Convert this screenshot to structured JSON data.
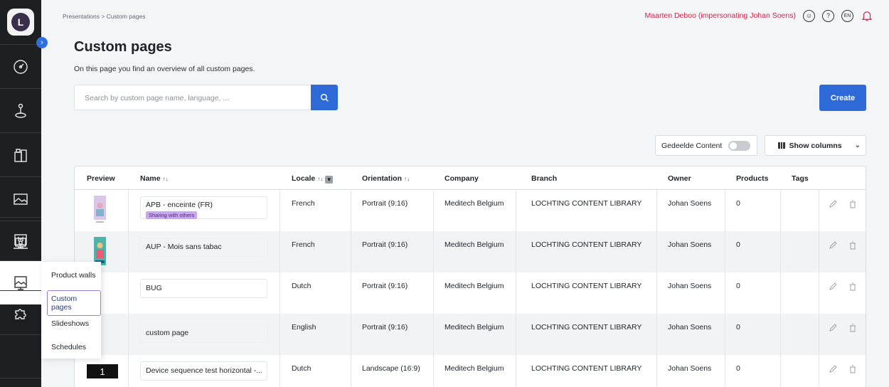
{
  "breadcrumb": "Presentations  >  Custom pages",
  "user": {
    "name": "Maarten Deboo (impersonating Johan Soens)",
    "help": "?",
    "lang": "EN"
  },
  "page": {
    "title": "Custom pages",
    "subtitle": "On this page you find an overview of all custom pages."
  },
  "search": {
    "placeholder": "Search by custom page name, language, ..."
  },
  "create_label": "Create",
  "shared_toggle_label": "Gedeelde Content",
  "show_columns_label": "Show columns",
  "submenu": [
    "Product walls",
    "Custom pages",
    "Slideshows",
    "Schedules"
  ],
  "columns": {
    "preview": "Preview",
    "name": "Name",
    "locale": "Locale",
    "orientation": "Orientation",
    "company": "Company",
    "branch": "Branch",
    "owner": "Owner",
    "products": "Products",
    "tags": "Tags"
  },
  "rows": [
    {
      "name": "APB - enceinte (FR)",
      "badge": "Sharing with others",
      "locale": "French",
      "orientation": "Portrait (9:16)",
      "company": "Meditech Belgium",
      "branch": "LOCHTING CONTENT LIBRARY",
      "owner": "Johan Soens",
      "products": "0"
    },
    {
      "name": "AUP - Mois sans tabac",
      "locale": "French",
      "orientation": "Portrait (9:16)",
      "company": "Meditech Belgium",
      "branch": "LOCHTING CONTENT LIBRARY",
      "owner": "Johan Soens",
      "products": "0"
    },
    {
      "name": "BUG",
      "locale": "Dutch",
      "orientation": "Portrait (9:16)",
      "company": "Meditech Belgium",
      "branch": "LOCHTING CONTENT LIBRARY",
      "owner": "Johan Soens",
      "products": "0"
    },
    {
      "name": "custom page",
      "locale": "English",
      "orientation": "Portrait (9:16)",
      "company": "Meditech Belgium",
      "branch": "LOCHTING CONTENT LIBRARY",
      "owner": "Johan Soens",
      "products": "0"
    },
    {
      "name": "Device sequence test horizontal -...",
      "preview_tag": "1",
      "locale": "Dutch",
      "orientation": "Landscape (16:9)",
      "company": "Meditech Belgium",
      "branch": "LOCHTING CONTENT LIBRARY",
      "owner": "Johan Soens",
      "products": "0"
    }
  ],
  "colors": {
    "accent": "#2d6ad8",
    "user": "#d0234a",
    "badge": "#c9a8f0",
    "sidebar": "#1e1f21"
  }
}
